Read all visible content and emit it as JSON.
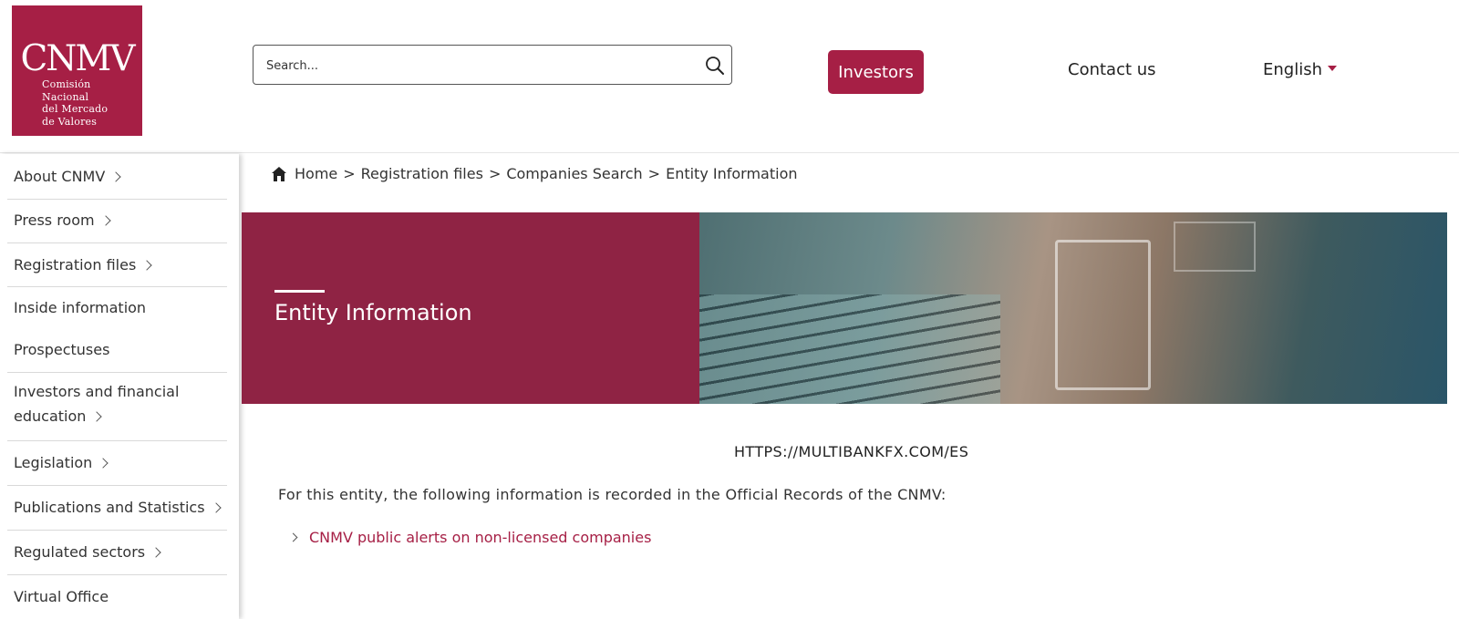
{
  "brand": {
    "logo_mark": "CNMV",
    "logo_lines": [
      "Comisión",
      "Nacional",
      "del Mercado",
      "de Valores"
    ],
    "accent_color": "#a61f45"
  },
  "header": {
    "search_placeholder": "Search...",
    "search_icon": "search-icon",
    "investors_label": "Investors",
    "contact_label": "Contact us",
    "language_label": "English"
  },
  "sidebar": {
    "items": [
      {
        "label": "About CNMV",
        "has_submenu": true
      },
      {
        "label": "Press room",
        "has_submenu": true
      },
      {
        "label": "Registration files",
        "has_submenu": true
      },
      {
        "label": "Inside information",
        "has_submenu": false
      },
      {
        "label": "Prospectuses",
        "has_submenu": false
      },
      {
        "label_line1": "Investors and financial",
        "label_line2": "education",
        "has_submenu": true
      },
      {
        "label": "Legislation",
        "has_submenu": true
      },
      {
        "label": "Publications and Statistics",
        "has_submenu": true
      },
      {
        "label": "Regulated sectors",
        "has_submenu": true
      },
      {
        "label": "Virtual Office",
        "has_submenu": false
      }
    ]
  },
  "breadcrumb": {
    "home": "Home",
    "sep": ">",
    "items": [
      "Registration files",
      "Companies Search",
      "Entity Information"
    ]
  },
  "banner": {
    "title": "Entity Information"
  },
  "main": {
    "entity_url": "HTTPS://MULTIBANKFX.COM/ES",
    "records_text": "For this entity, the following information is recorded in the Official Records of the CNMV:",
    "alert_link": "CNMV public alerts on non-licensed companies"
  }
}
